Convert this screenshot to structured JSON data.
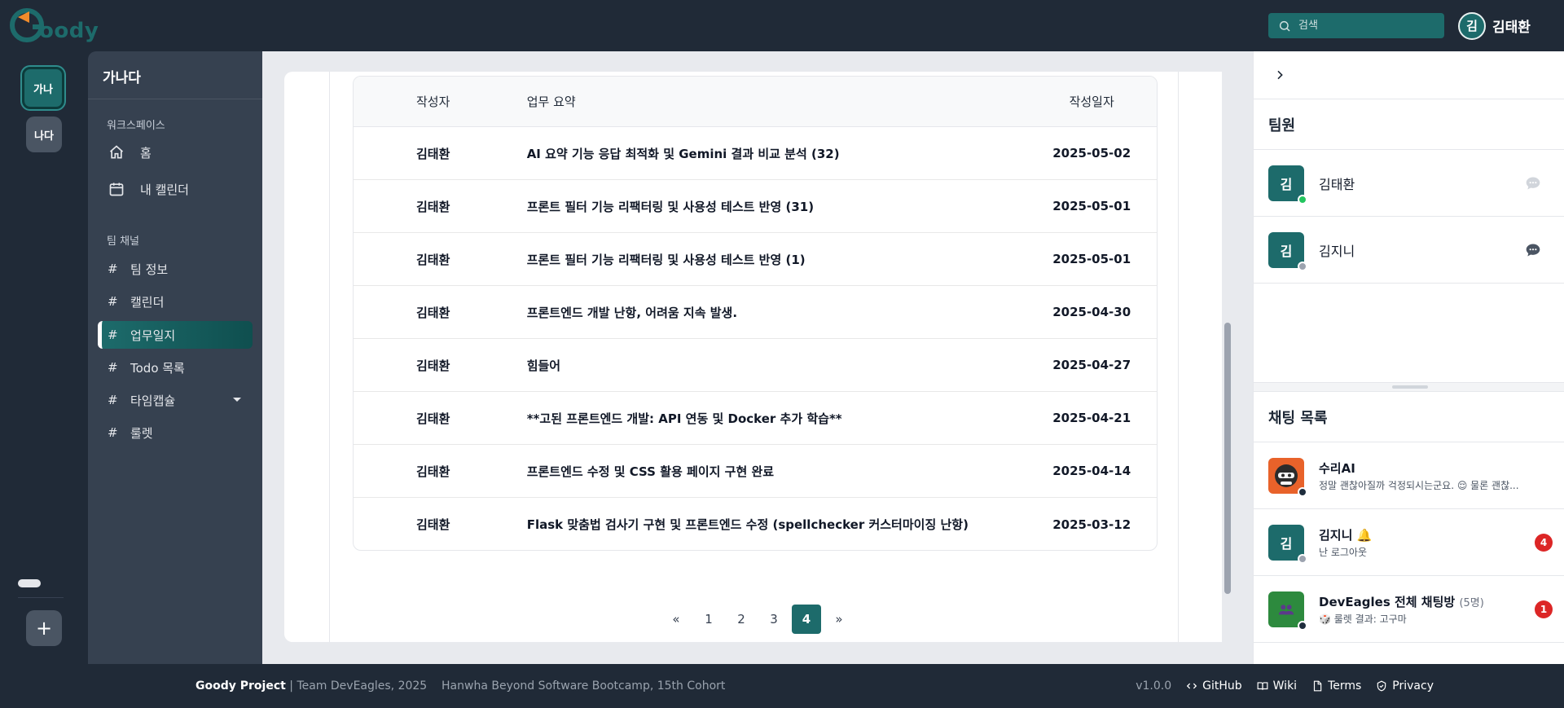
{
  "header": {
    "logo_text": "oody",
    "search_placeholder": "검색",
    "user": {
      "avatar": "김",
      "name": "김태환"
    }
  },
  "workspaces": {
    "active": "가나",
    "other": "나다",
    "add_label": "+"
  },
  "sidebar": {
    "title": "가나다",
    "workspace_section": "워크스페이스",
    "workspace_items": [
      {
        "label": "홈",
        "icon": "home-icon"
      },
      {
        "label": "내 캘린더",
        "icon": "calendar-icon"
      }
    ],
    "channel_section": "팀 채널",
    "channels": [
      {
        "label": "팀 정보"
      },
      {
        "label": "캘린더"
      },
      {
        "label": "업무일지",
        "active": true
      },
      {
        "label": "Todo 목록"
      },
      {
        "label": "타임캡슐",
        "has_dropdown": true
      },
      {
        "label": "룰렛"
      }
    ]
  },
  "table": {
    "headers": {
      "author": "작성자",
      "summary": "업무 요약",
      "date": "작성일자"
    },
    "rows": [
      {
        "author": "김태환",
        "summary": "AI 요약 기능 응답 최적화 및 Gemini 결과 비교 분석 (32)",
        "date": "2025-05-02"
      },
      {
        "author": "김태환",
        "summary": "프론트 필터 기능 리팩터링 및 사용성 테스트 반영 (31)",
        "date": "2025-05-01"
      },
      {
        "author": "김태환",
        "summary": "프론트 필터 기능 리팩터링 및 사용성 테스트 반영 (1)",
        "date": "2025-05-01"
      },
      {
        "author": "김태환",
        "summary": "프론트엔드 개발 난항, 어려움 지속 발생.",
        "date": "2025-04-30"
      },
      {
        "author": "김태환",
        "summary": "힘들어",
        "date": "2025-04-27"
      },
      {
        "author": "김태환",
        "summary": "**고된 프론트엔드 개발: API 연동 및 Docker 추가 학습**",
        "date": "2025-04-21"
      },
      {
        "author": "김태환",
        "summary": "프론트엔드 수정 및 CSS 활용 페이지 구현 완료",
        "date": "2025-04-14"
      },
      {
        "author": "김태환",
        "summary": "Flask 맞춤법 검사기 구현 및 프론트엔드 수정 (spellchecker 커스터마이징 난항)",
        "date": "2025-03-12"
      }
    ]
  },
  "pagination": {
    "prev": "«",
    "pages": [
      "1",
      "2",
      "3",
      "4"
    ],
    "current": "4",
    "next": "»"
  },
  "right_panel": {
    "members_title": "팀원",
    "members": [
      {
        "avatar": "김",
        "name": "김태환",
        "status": "online"
      },
      {
        "avatar": "김",
        "name": "김지니",
        "status": "offline"
      }
    ],
    "chat_title": "채팅 목록",
    "chats": [
      {
        "name": "수리AI",
        "preview": "정말 괜찮아질까 걱정되시는군요. 😌 물론 괜찮...",
        "avatar": "robot",
        "badge": ""
      },
      {
        "name": "김지니 🔔",
        "preview": "난 로그아웃",
        "avatar": "김",
        "badge": "4"
      },
      {
        "name": "DevEagles 전체 채팅방",
        "count": "(5명)",
        "preview": "🎲 룰렛 결과: 고구마",
        "avatar": "group",
        "badge": "1"
      }
    ]
  },
  "footer": {
    "brand": "Goody Project",
    "team": " | Team DevEagles, 2025",
    "course": "Hanwha Beyond Software Bootcamp, 15th Cohort",
    "version": "v1.0.0",
    "links": [
      "GitHub",
      "Wiki",
      "Terms",
      "Privacy"
    ]
  },
  "colors": {
    "accent": "#1d6b6b",
    "dark": "#202a37",
    "sidebar": "#364150",
    "badge": "#dc2626"
  }
}
